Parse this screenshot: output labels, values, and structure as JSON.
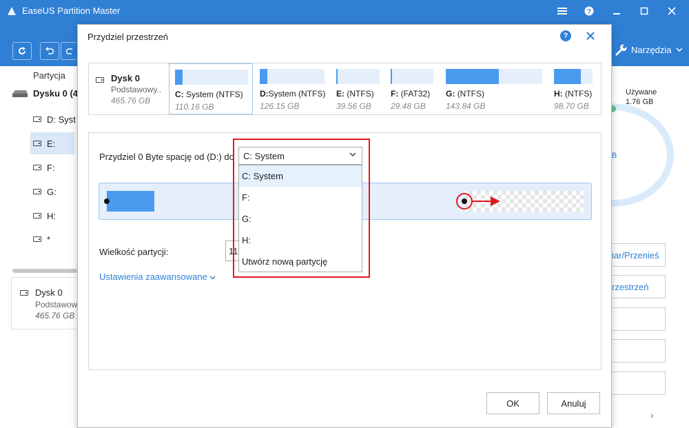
{
  "app": {
    "title": "EaseUS Partition Master",
    "window_buttons": [
      "menu-icon",
      "help-icon",
      "minimize-icon",
      "maximize-icon",
      "close-icon"
    ],
    "toolbar": {
      "tools_label": "Narzędzia"
    },
    "colors": {
      "accent": "#2f7fd5",
      "partition_fill": "#4a9bef",
      "partition_bg": "#e4effb",
      "highlight_red": "#e0181f"
    }
  },
  "left_panel": {
    "header": "Partycja",
    "disk_label": "Dysku 0 (4",
    "items": [
      {
        "label": "D: Syst"
      },
      {
        "label": "E:"
      },
      {
        "label": "F:"
      },
      {
        "label": "G:"
      },
      {
        "label": "H:"
      },
      {
        "label": "*"
      }
    ],
    "card": {
      "name": "Dysk 0",
      "type": "Podstawow",
      "size": "465.76 GB"
    }
  },
  "right_panel": {
    "used_label": "Używane",
    "used_value": "1.76 GB",
    "donut_text": "B",
    "buttons": [
      {
        "label": "iar/Przenieś"
      },
      {
        "label": "rzestrzeń"
      },
      {
        "label": ""
      },
      {
        "label": ""
      },
      {
        "label": ""
      }
    ]
  },
  "dialog": {
    "title": "Przydziel przestrzeń",
    "disk": {
      "name": "Dysk 0",
      "type": "Podstawowy..",
      "size": "465.76 GB"
    },
    "partitions": [
      {
        "letter": "C:",
        "name": "System (NTFS)",
        "size": "110.16 GB",
        "fill": 0.1,
        "selected": true
      },
      {
        "letter": "D:",
        "name": "System (NTFS)",
        "size": "126.15 GB",
        "fill": 0.12,
        "selected": false
      },
      {
        "letter": "E:",
        "name": "(NTFS)",
        "size": "39.56 GB",
        "fill": 0.03,
        "selected": false
      },
      {
        "letter": "F:",
        "name": "(FAT32)",
        "size": "29.48 GB",
        "fill": 0.03,
        "selected": false
      },
      {
        "letter": "G:",
        "name": "(NTFS)",
        "size": "143.84 GB",
        "fill": 0.55,
        "selected": false
      },
      {
        "letter": "H:",
        "name": "(NTFS)",
        "size": "98.70 GB",
        "fill": 0.7,
        "selected": false
      }
    ],
    "allocate_text": "Przydziel 0 Byte spację od (D:) do",
    "combo": {
      "selected": "C: System",
      "options": [
        "C: System",
        "F:",
        "G:",
        "H:",
        "Utwórz nową partycję"
      ]
    },
    "slider": {
      "used_fraction": 0.1,
      "free_fraction": 0.25
    },
    "size_label": "Wielkość partycji:",
    "size_value": "11",
    "advanced_link": "Ustawienia zaawansowane",
    "ok_label": "OK",
    "cancel_label": "Anuluj"
  }
}
